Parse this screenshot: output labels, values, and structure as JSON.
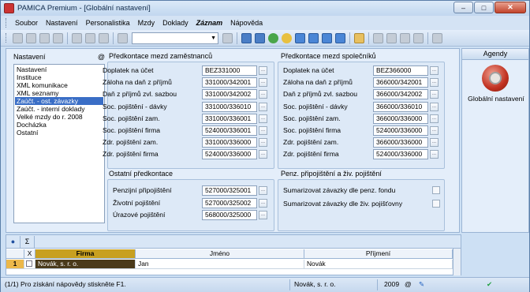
{
  "window": {
    "title": "PAMICA Premium - [Globální nastavení]",
    "min": "–",
    "max": "□",
    "close": "✕"
  },
  "menu": [
    "Soubor",
    "Nastavení",
    "Personalistika",
    "Mzdy",
    "Doklady",
    "Záznam",
    "Nápověda"
  ],
  "nav": {
    "title": "Nastavení",
    "at_symbol": "@",
    "items": [
      "Nastavení",
      "Instituce",
      "XML komunikace",
      "XML seznamy",
      "Zaúčt. - ost. závazky",
      "Zaúčt. - interní doklady",
      "Velké mzdy do r. 2008",
      "Docházka",
      "Ostatní"
    ]
  },
  "employee": {
    "title": "Předkontace mezd zaměstnanců",
    "rows": [
      {
        "label": "Doplatek na účet",
        "value": "BEZ331000"
      },
      {
        "label": "Záloha na daň z příjmů",
        "value": "331000/342001"
      },
      {
        "label": "Daň z příjmů zvl. sazbou",
        "value": "331000/342002"
      },
      {
        "label": "Soc. pojištění - dávky",
        "value": "331000/336010"
      },
      {
        "label": "Soc. pojištění zam.",
        "value": "331000/336001"
      },
      {
        "label": "Soc. pojištění firma",
        "value": "524000/336001"
      },
      {
        "label": "Zdr. pojištění zam.",
        "value": "331000/336000"
      },
      {
        "label": "Zdr. pojištění firma",
        "value": "524000/336000"
      }
    ]
  },
  "company": {
    "title": "Předkontace mezd společníků",
    "rows": [
      {
        "label": "Doplatek na účet",
        "value": "BEZ366000"
      },
      {
        "label": "Záloha na daň z příjmů",
        "value": "366000/342001"
      },
      {
        "label": "Daň z příjmů zvl. sazbou",
        "value": "366000/342002"
      },
      {
        "label": "Soc. pojištění - dávky",
        "value": "366000/336010"
      },
      {
        "label": "Soc. pojištění zam.",
        "value": "366000/336000"
      },
      {
        "label": "Soc. pojištění firma",
        "value": "524000/336000"
      },
      {
        "label": "Zdr. pojištění zam.",
        "value": "366000/336000"
      },
      {
        "label": "Zdr. pojištění firma",
        "value": "524000/336000"
      }
    ]
  },
  "other": {
    "title": "Ostatní předkontace",
    "rows": [
      {
        "label": "Penzijní připojištění",
        "value": "527000/325001"
      },
      {
        "label": "Životní pojištění",
        "value": "527000/325002"
      },
      {
        "label": "Úrazové pojištění",
        "value": "568000/325000"
      }
    ]
  },
  "pension": {
    "title": "Penz. připojištění a živ. pojištění",
    "rows": [
      {
        "label": "Sumarizovat závazky dle penz. fondu"
      },
      {
        "label": "Sumarizovat závazky dle živ. pojišťovny"
      }
    ]
  },
  "ellipsis": "...",
  "agendy": {
    "title": "Agendy",
    "item": "Globální nastavení"
  },
  "grid": {
    "tab1": "●",
    "tab2": "Σ",
    "headers": {
      "x": "X",
      "firma": "Firma",
      "jmeno": "Jméno",
      "prijmeni": "Příjmení"
    },
    "row": {
      "num": "1",
      "firma": "Novák, s. r. o.",
      "jmeno": "Jan",
      "prijmeni": "Novák"
    }
  },
  "status": {
    "help": "(1/1) Pro získání nápovědy stiskněte F1.",
    "company": "Novák, s. r. o.",
    "year": "2009",
    "at": "@",
    "check": "✔"
  }
}
